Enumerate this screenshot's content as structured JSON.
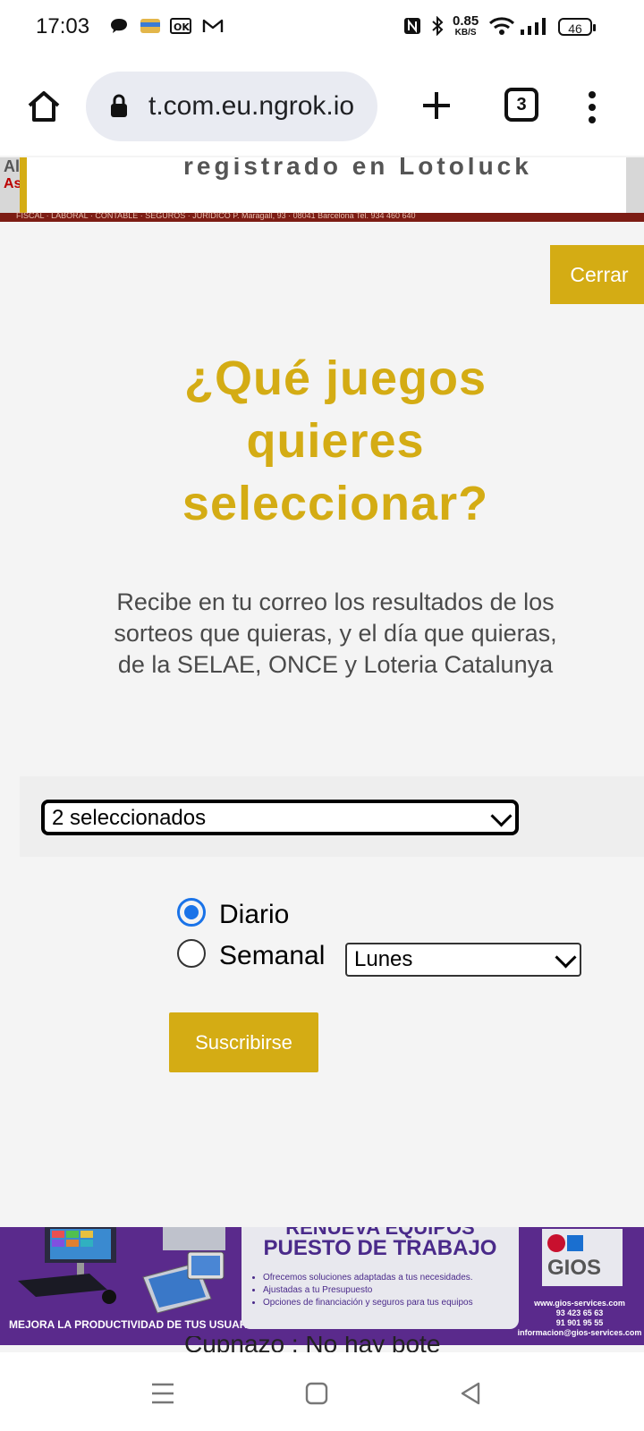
{
  "status_bar": {
    "time": "17:03",
    "net_speed_value": "0.85",
    "net_speed_unit": "KB/S",
    "battery": "46"
  },
  "browser": {
    "url": "t.com.eu.ngrok.io",
    "tab_count": "3"
  },
  "top_banner": {
    "text": "registrado en Lotoluck",
    "left_stub_1": "Al",
    "left_stub_2": "As",
    "strip_text": "FISCAL · LABORAL · CONTABLE · SEGUROS · JURIDICO       P. Maragall, 93 · 08041 Barcelona       Tel. 934 460 640"
  },
  "modal": {
    "close_label": "Cerrar",
    "title_line1": "¿Qué juegos",
    "title_line2": "quieres",
    "title_line3": "seleccionar?",
    "subtitle_line1": "Recibe en tu correo los resultados de los",
    "subtitle_line2": "sorteos que quieras, y el día que quieras,",
    "subtitle_line3": "de la SELAE, ONCE y Loteria Catalunya",
    "games_select_value": "2 seleccionados",
    "radio_daily_label": "Diario",
    "radio_weekly_label": "Semanal",
    "day_select_value": "Lunes",
    "subscribe_label": "Suscribirse"
  },
  "bottom_ad": {
    "headline_1": "RENUEVA EQUIPOS",
    "headline_2": "PUESTO DE TRABAJO",
    "bullet_1": "Ofrecemos soluciones adaptadas a tus necesidades.",
    "bullet_2": "Ajustadas a tu Presupuesto",
    "bullet_3": "Opciones de financiación y seguros para tus equipos",
    "tagline": "MEJORA LA PRODUCTIVIDAD DE TUS USUARIOS",
    "brand": "GIOS",
    "web": "www.gios-services.com",
    "phone_1": "93 423 65 63",
    "phone_2": "91 901 95 55",
    "email": "informacion@gios-services.com",
    "peek_text": "Cupnazo : No hay bote"
  },
  "colors": {
    "accent": "#d4ac14",
    "radio_blue": "#1a73e8",
    "ad_purple": "#5a2a8c"
  }
}
